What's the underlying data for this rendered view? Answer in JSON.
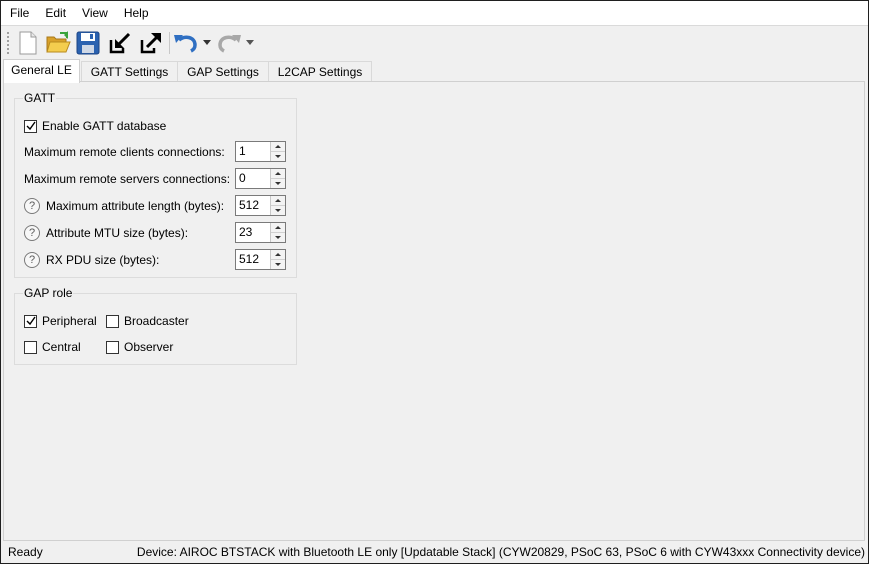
{
  "menu": [
    "File",
    "Edit",
    "View",
    "Help"
  ],
  "toolbar": {
    "icons": [
      "new-file-icon",
      "open-folder-icon",
      "save-icon",
      "import-icon",
      "export-icon",
      "undo-icon",
      "redo-icon"
    ]
  },
  "tabs": [
    "General LE",
    "GATT Settings",
    "GAP Settings",
    "L2CAP Settings"
  ],
  "active_tab": "General LE",
  "gatt": {
    "title": "GATT",
    "enable_label": "Enable GATT database",
    "enable_checked": true,
    "fields": [
      {
        "label": "Maximum remote clients connections:",
        "value": "1",
        "help": false
      },
      {
        "label": "Maximum remote servers connections:",
        "value": "0",
        "help": false
      },
      {
        "label": "Maximum attribute length (bytes):",
        "value": "512",
        "help": true
      },
      {
        "label": "Attribute MTU size (bytes):",
        "value": "23",
        "help": true
      },
      {
        "label": "RX PDU size (bytes):",
        "value": "512",
        "help": true
      }
    ]
  },
  "gap_role": {
    "title": "GAP role",
    "options": [
      {
        "label": "Peripheral",
        "checked": true
      },
      {
        "label": "Broadcaster",
        "checked": false
      },
      {
        "label": "Central",
        "checked": false
      },
      {
        "label": "Observer",
        "checked": false
      }
    ]
  },
  "status": {
    "left": "Ready",
    "right": "Device: AIROC BTSTACK with Bluetooth LE only [Updatable Stack] (CYW20829, PSoC 63, PSoC 6 with CYW43xxx Connectivity device)"
  },
  "colors": {
    "undo_blue": "#2f6fc2",
    "folder_yellow": "#e8b83a",
    "save_blue": "#2b62b0"
  }
}
